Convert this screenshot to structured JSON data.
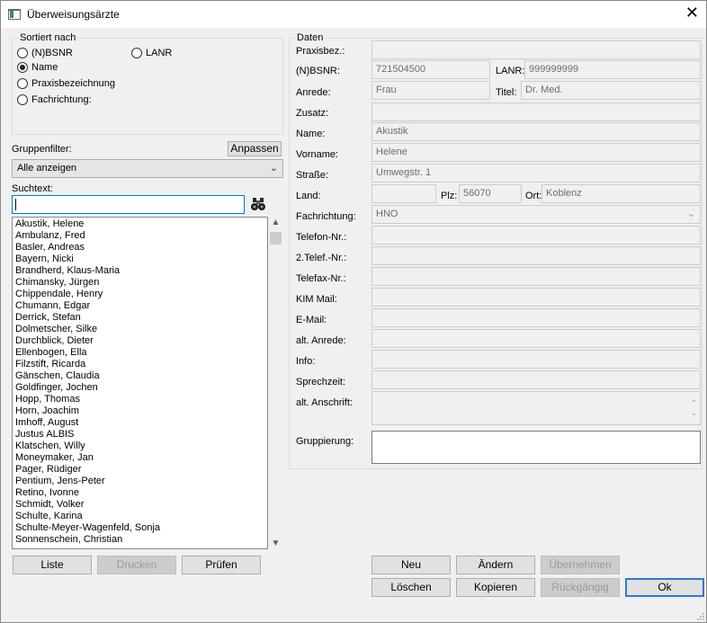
{
  "window": {
    "title": "Überweisungsärzte",
    "close_symbol": "✕"
  },
  "sort": {
    "legend": "Sortiert nach",
    "options": [
      {
        "label": "(N)BSNR",
        "checked": false
      },
      {
        "label": "LANR",
        "checked": false
      },
      {
        "label": "Name",
        "checked": true
      },
      {
        "label": "Praxisbezeichnung",
        "checked": false
      },
      {
        "label": "Fachrichtung:",
        "checked": false
      }
    ]
  },
  "group_filter": {
    "label": "Gruppenfilter:",
    "adjust_button": "Anpassen",
    "selected": "Alle anzeigen"
  },
  "search": {
    "label": "Suchtext:",
    "value": ""
  },
  "list": {
    "items": [
      "Akustik, Helene",
      "Ambulanz, Fred",
      "Basler, Andreas",
      "Bayern, Nicki",
      "Brandherd, Klaus-Maria",
      "Chimansky, Jürgen",
      "Chippendale, Henry",
      "Chumann, Edgar",
      "Derrick, Stefan",
      "Dolmetscher, Silke",
      "Durchblick, Dieter",
      "Ellenbogen, Ella",
      "Filzstift, Ricarda",
      "Gänschen, Claudia",
      "Goldfinger, Jochen",
      "Hopp, Thomas",
      "Horn, Joachim",
      "Imhoff, August",
      "Justus  ALBIS",
      "Klatschen, Willy",
      "Moneymaker, Jan",
      "Pager, Rüdiger",
      "Pentium, Jens-Peter",
      "Retino, Ivonne",
      "Schmidt, Volker",
      "Schulte, Karina",
      "Schulte-Meyer-Wagenfeld, Sonja",
      "Sonnenschein, Christian"
    ]
  },
  "left_buttons": {
    "list": "Liste",
    "print": "Drucken",
    "check": "Prüfen"
  },
  "details": {
    "legend": "Daten",
    "labels": {
      "praxisbez": "Praxisbez.:",
      "bsnr": "(N)BSNR:",
      "lanr": "LANR:",
      "anrede": "Anrede:",
      "titel": "Titel:",
      "zusatz": "Zusatz:",
      "name": "Name:",
      "vorname": "Vorname:",
      "strasse": "Straße:",
      "land": "Land:",
      "plz": "Plz:",
      "ort": "Ort:",
      "fachrichtung": "Fachrichtung:",
      "telefon": "Telefon-Nr.:",
      "telefon2": "2.Telef.-Nr.:",
      "telefax": "Telefax-Nr.:",
      "kim": "KIM Mail:",
      "email": "E-Mail:",
      "alt_anrede": "alt. Anrede:",
      "info": "Info:",
      "sprechzeit": "Sprechzeit:",
      "alt_anschrift": "alt. Anschrift:",
      "gruppierung": "Gruppierung:"
    },
    "values": {
      "praxisbez": "",
      "bsnr": "721504500",
      "lanr": "999999999",
      "anrede": "Frau",
      "titel": "Dr. Med.",
      "zusatz": "",
      "name": "Akustik",
      "vorname": "Helene",
      "strasse": "Umwegstr. 1",
      "land": "",
      "plz": "56070",
      "ort": "Koblenz",
      "fachrichtung": "HNO",
      "telefon": "",
      "telefon2": "",
      "telefax": "",
      "kim": "",
      "email": "",
      "alt_anrede": "",
      "info": "",
      "sprechzeit": "",
      "alt_anschrift": "",
      "gruppierung": ""
    }
  },
  "bottom_buttons": {
    "new": "Neu",
    "change": "Ändern",
    "apply": "Übernehmen",
    "delete": "Löschen",
    "copy": "Kopieren",
    "undo": "Rückgängig",
    "ok": "Ok"
  }
}
